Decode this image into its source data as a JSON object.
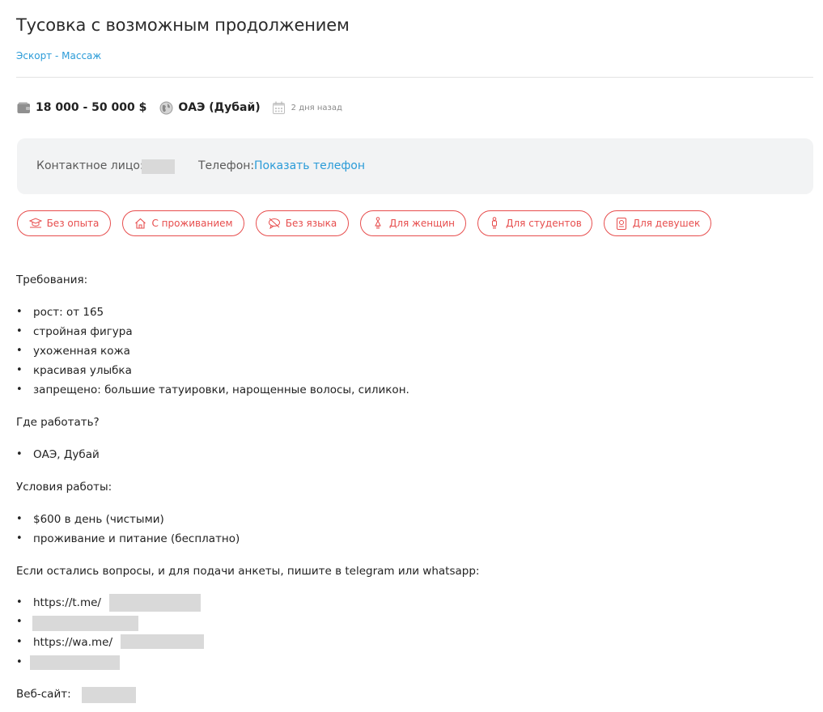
{
  "title": "Тусовка с возможным продолжением",
  "breadcrumb": {
    "text": "Эскорт - Массаж"
  },
  "meta": {
    "salary": "18 000 - 50 000 $",
    "location": "ОАЭ (Дубай)",
    "posted": "2 дня назад",
    "icons": [
      "wallet-icon",
      "globe-icon",
      "calendar-icon"
    ]
  },
  "contact": {
    "person_label": "Контактное лицо:",
    "phone_label": "Телефон:",
    "phone_link": "Показать телефон"
  },
  "tags": [
    {
      "label": "Без опыта",
      "icon": "graduation-icon"
    },
    {
      "label": "С проживанием",
      "icon": "house-icon"
    },
    {
      "label": "Без языка",
      "icon": "speech-off-icon"
    },
    {
      "label": "Для женщин",
      "icon": "woman-icon"
    },
    {
      "label": "Для студентов",
      "icon": "student-icon"
    },
    {
      "label": "Для девушек",
      "icon": "passport-icon"
    }
  ],
  "description": {
    "requirements_heading": "Требования:",
    "requirements": [
      "рост: от 165",
      "стройная фигура",
      "ухоженная кожа",
      "красивая улыбка",
      "запрещено: большие татуировки, нарощенные волосы, силикон."
    ],
    "where_heading": "Где работать?",
    "where": [
      "ОАЭ, Дубай"
    ],
    "conditions_heading": "Условия работы:",
    "conditions": [
      "$600 в день (чистыми)",
      "проживание и питание (бесплатно)"
    ],
    "apply_text": "Если остались вопросы, и для подачи анкеты, пишите в telegram или whatsapp:",
    "links": [
      "https://t.me/",
      "",
      "https://wa.me/",
      ""
    ],
    "website_label": "Веб-сайт:",
    "bullet": "•"
  },
  "colors": {
    "accent": "#e74d4d",
    "link": "#2a9bd8",
    "panel": "#f2f3f4"
  }
}
